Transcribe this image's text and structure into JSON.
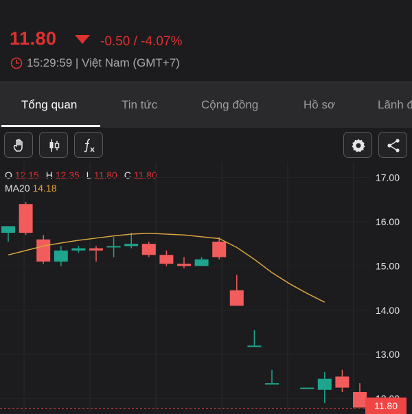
{
  "quote": {
    "price": "11.80",
    "change": "-0.50 / -4.07%",
    "time": "15:29:59 | Việt Nam (GMT+7)"
  },
  "tabs": [
    {
      "label": "Tổng quan",
      "active": true
    },
    {
      "label": "Tin tức",
      "active": false
    },
    {
      "label": "Cộng đồng",
      "active": false
    },
    {
      "label": "Hồ sơ",
      "active": false
    },
    {
      "label": "Lãnh đ",
      "active": false
    }
  ],
  "toolbar": {
    "icons": [
      "hand-pointer-icon",
      "candlestick-icon",
      "function-icon",
      "gear-icon",
      "share-icon"
    ]
  },
  "ohlc": {
    "o_label": "O",
    "o": "12.15",
    "h_label": "H",
    "h": "12.35",
    "l_label": "L",
    "l": "11.80",
    "c_label": "C",
    "c": "11.80"
  },
  "ma": {
    "label": "MA20",
    "value": "14.18"
  },
  "colors": {
    "up": "#1fa58f",
    "down": "#f25c5c",
    "ma": "#d9a441",
    "accent": "#e03131"
  },
  "chart_data": {
    "type": "candlestick",
    "y_ticks": [
      "17.00",
      "16.00",
      "15.00",
      "14.00",
      "13.00",
      "12.00"
    ],
    "ylim": [
      11.7,
      17.35
    ],
    "last_price_label": "11.80",
    "candles": [
      {
        "o": 15.75,
        "h": 15.85,
        "l": 15.55,
        "c": 15.9,
        "dir": "up"
      },
      {
        "o": 16.4,
        "h": 16.45,
        "l": 15.7,
        "c": 15.75,
        "dir": "down"
      },
      {
        "o": 15.6,
        "h": 15.7,
        "l": 15.05,
        "c": 15.1,
        "dir": "down"
      },
      {
        "o": 15.1,
        "h": 15.45,
        "l": 15.0,
        "c": 15.35,
        "dir": "up"
      },
      {
        "o": 15.4,
        "h": 15.45,
        "l": 15.3,
        "c": 15.35,
        "dir": "up"
      },
      {
        "o": 15.4,
        "h": 15.45,
        "l": 15.1,
        "c": 15.35,
        "dir": "down"
      },
      {
        "o": 15.45,
        "h": 15.65,
        "l": 15.2,
        "c": 15.45,
        "dir": "up"
      },
      {
        "o": 15.45,
        "h": 15.75,
        "l": 15.4,
        "c": 15.5,
        "dir": "up"
      },
      {
        "o": 15.5,
        "h": 15.55,
        "l": 15.2,
        "c": 15.25,
        "dir": "down"
      },
      {
        "o": 15.25,
        "h": 15.35,
        "l": 15.0,
        "c": 15.05,
        "dir": "down"
      },
      {
        "o": 15.05,
        "h": 15.2,
        "l": 14.95,
        "c": 15.0,
        "dir": "down"
      },
      {
        "o": 15.0,
        "h": 15.2,
        "l": 15.0,
        "c": 15.15,
        "dir": "up"
      },
      {
        "o": 15.55,
        "h": 15.65,
        "l": 15.15,
        "c": 15.2,
        "dir": "down"
      },
      {
        "o": 14.45,
        "h": 14.8,
        "l": 14.1,
        "c": 14.1,
        "dir": "down"
      },
      {
        "o": 13.2,
        "h": 13.55,
        "l": 13.2,
        "c": 13.2,
        "dir": "up"
      },
      {
        "o": 12.35,
        "h": 12.65,
        "l": 12.35,
        "c": 12.35,
        "dir": "up"
      },
      {
        "o": null,
        "h": null,
        "l": null,
        "c": null,
        "dir": "none"
      },
      {
        "o": 12.25,
        "h": 12.25,
        "l": 12.25,
        "c": 12.25,
        "dir": "up"
      },
      {
        "o": 12.2,
        "h": 12.6,
        "l": 11.9,
        "c": 12.45,
        "dir": "up"
      },
      {
        "o": 12.5,
        "h": 12.65,
        "l": 12.15,
        "c": 12.25,
        "dir": "down"
      },
      {
        "o": 12.15,
        "h": 12.35,
        "l": 11.8,
        "c": 11.8,
        "dir": "down"
      }
    ],
    "ma20": [
      15.25,
      15.35,
      15.45,
      15.52,
      15.58,
      15.63,
      15.68,
      15.72,
      15.74,
      15.72,
      15.7,
      15.66,
      15.62,
      15.42,
      15.15,
      14.85,
      14.6,
      14.38,
      14.18
    ]
  }
}
